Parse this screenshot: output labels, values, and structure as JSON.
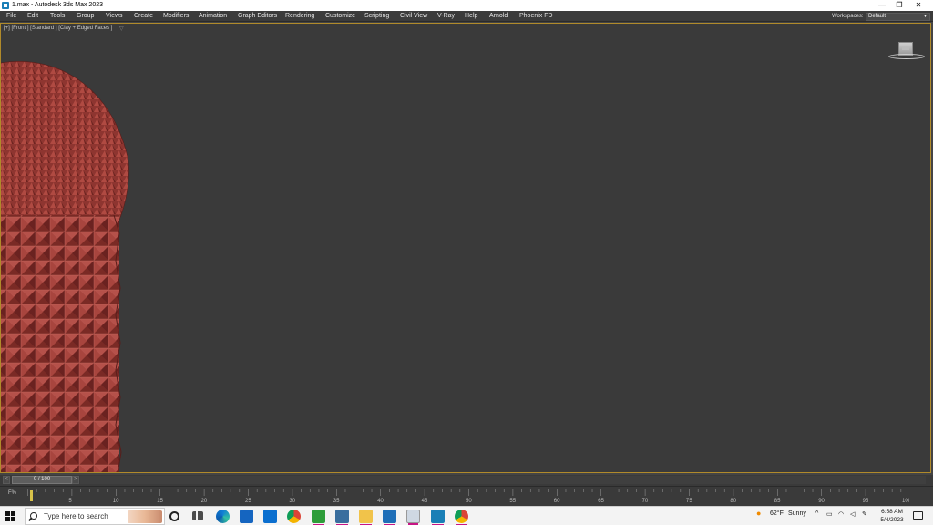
{
  "titlebar": {
    "title": "1.max - Autodesk 3ds Max 2023",
    "minimize": "—",
    "restore": "❐",
    "close": "✕"
  },
  "menubar": {
    "items": [
      "File",
      "Edit",
      "Tools",
      "Group",
      "Views",
      "Create",
      "Modifiers",
      "Animation",
      "Graph Editors",
      "Rendering",
      "Customize",
      "Scripting",
      "Civil View",
      "V-Ray",
      "Help",
      "Arnold",
      "Phoenix FD"
    ],
    "workspaces_label": "Workspaces:",
    "workspaces_value": "Default"
  },
  "viewport": {
    "label": "[+] [Front ] [Standard ] [Clay + Edged Faces ]",
    "filter_icon": "filter-icon",
    "model_color": "#a0403a",
    "border_color": "#b08a2a"
  },
  "timeslider": {
    "prev": "<",
    "next": ">",
    "frame": "0 / 100"
  },
  "trackbar": {
    "key_icon": "F%",
    "ticks": [
      "5",
      "10",
      "15",
      "20",
      "25",
      "30",
      "35",
      "40",
      "45",
      "50",
      "55",
      "60",
      "65",
      "70",
      "75",
      "80",
      "85",
      "90",
      "95",
      "100"
    ]
  },
  "taskbar": {
    "search_placeholder": "Type here to search",
    "weather_temp": "62°F",
    "weather_desc": "Sunny",
    "time": "6:58 AM",
    "date": "5/4/2023",
    "tray_chevron": "^",
    "icons": [
      "cortana-icon",
      "task-view-icon",
      "edge-icon",
      "store-icon",
      "mail-icon",
      "chrome-icon",
      "camtasia-icon",
      "app-icon",
      "file-explorer-icon",
      "photos-icon",
      "app2-icon",
      "3dsmax-icon",
      "chrome2-icon"
    ]
  }
}
